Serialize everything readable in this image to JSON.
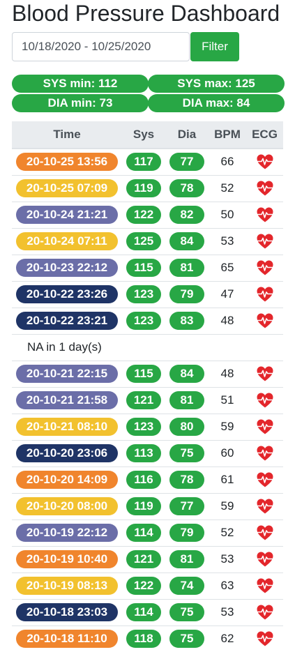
{
  "page": {
    "title": "Blood Pressure Dashboard"
  },
  "filter": {
    "date_range": "10/18/2020 - 10/25/2020",
    "button_label": "Filter"
  },
  "stats": {
    "sys_min": "SYS min: 112",
    "sys_max": "SYS max: 125",
    "dia_min": "DIA min: 73",
    "dia_max": "DIA max: 84"
  },
  "colors": {
    "green": "#28a745",
    "orange": "#f0852d",
    "yellow": "#f2c12e",
    "slate": "#6b6ea8",
    "navy": "#1f3466",
    "heart": "#e3262b"
  },
  "table": {
    "headers": [
      "Time",
      "Sys",
      "Dia",
      "BPM",
      "ECG"
    ],
    "rows": [
      {
        "time": "20-10-25 13:56",
        "color": "orange",
        "sys": "117",
        "dia": "77",
        "bpm": "66",
        "ecg": "heart-ecg-icon"
      },
      {
        "time": "20-10-25 07:09",
        "color": "yellow",
        "sys": "119",
        "dia": "78",
        "bpm": "52",
        "ecg": "heart-ecg-icon"
      },
      {
        "time": "20-10-24 21:21",
        "color": "slate",
        "sys": "122",
        "dia": "82",
        "bpm": "50",
        "ecg": "heart-ecg-icon"
      },
      {
        "time": "20-10-24 07:11",
        "color": "yellow",
        "sys": "125",
        "dia": "84",
        "bpm": "53",
        "ecg": "heart-ecg-icon"
      },
      {
        "time": "20-10-23 22:12",
        "color": "slate",
        "sys": "115",
        "dia": "81",
        "bpm": "65",
        "ecg": "heart-ecg-icon"
      },
      {
        "time": "20-10-22 23:26",
        "color": "navy",
        "sys": "123",
        "dia": "79",
        "bpm": "47",
        "ecg": "heart-ecg-icon"
      },
      {
        "time": "20-10-22 23:21",
        "color": "navy",
        "sys": "123",
        "dia": "83",
        "bpm": "48",
        "ecg": "heart-ecg-icon"
      },
      {
        "na": "NA in 1 day(s)"
      },
      {
        "time": "20-10-21 22:15",
        "color": "slate",
        "sys": "115",
        "dia": "84",
        "bpm": "48",
        "ecg": "heart-ecg-icon"
      },
      {
        "time": "20-10-21 21:58",
        "color": "slate",
        "sys": "121",
        "dia": "81",
        "bpm": "51",
        "ecg": "heart-ecg-icon"
      },
      {
        "time": "20-10-21 08:10",
        "color": "yellow",
        "sys": "123",
        "dia": "80",
        "bpm": "59",
        "ecg": "heart-ecg-icon"
      },
      {
        "time": "20-10-20 23:06",
        "color": "navy",
        "sys": "113",
        "dia": "75",
        "bpm": "60",
        "ecg": "heart-ecg-icon"
      },
      {
        "time": "20-10-20 14:09",
        "color": "orange",
        "sys": "116",
        "dia": "78",
        "bpm": "61",
        "ecg": "heart-ecg-icon"
      },
      {
        "time": "20-10-20 08:00",
        "color": "yellow",
        "sys": "119",
        "dia": "77",
        "bpm": "59",
        "ecg": "heart-ecg-icon"
      },
      {
        "time": "20-10-19 22:12",
        "color": "slate",
        "sys": "114",
        "dia": "79",
        "bpm": "52",
        "ecg": "heart-ecg-icon"
      },
      {
        "time": "20-10-19 10:40",
        "color": "orange",
        "sys": "121",
        "dia": "81",
        "bpm": "53",
        "ecg": "heart-ecg-icon"
      },
      {
        "time": "20-10-19 08:13",
        "color": "yellow",
        "sys": "122",
        "dia": "74",
        "bpm": "63",
        "ecg": "heart-ecg-icon"
      },
      {
        "time": "20-10-18 23:03",
        "color": "navy",
        "sys": "114",
        "dia": "75",
        "bpm": "53",
        "ecg": "heart-ecg-icon"
      },
      {
        "time": "20-10-18 11:10",
        "color": "orange",
        "sys": "118",
        "dia": "75",
        "bpm": "62",
        "ecg": "heart-ecg-icon"
      }
    ]
  }
}
